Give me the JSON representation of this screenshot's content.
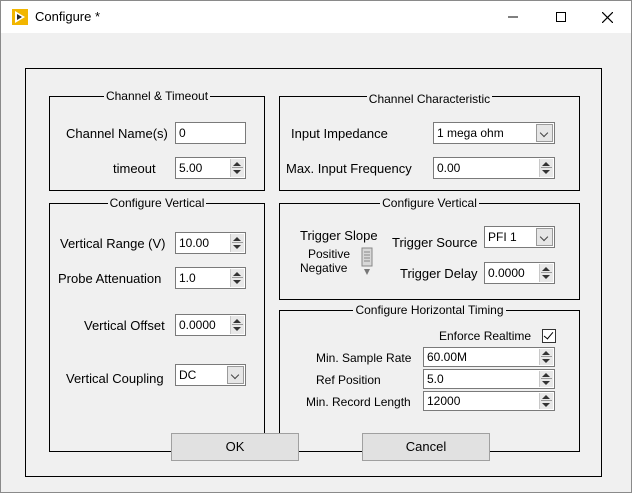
{
  "window": {
    "title": "Configure *",
    "icon": "labview-arrow-icon",
    "controls": [
      "minimize",
      "maximize",
      "close"
    ]
  },
  "channel_timeout": {
    "title": "Channel & Timeout",
    "channel_name_label": "Channel Name(s)",
    "channel_name_value": "0",
    "timeout_label": "timeout",
    "timeout_value": "5.00"
  },
  "channel_characteristic": {
    "title": "Channel Characteristic",
    "input_impedance_label": "Input Impedance",
    "input_impedance_value": "1 mega ohm",
    "max_freq_label": "Max. Input Frequency",
    "max_freq_value": "0.00"
  },
  "configure_vertical": {
    "title": "Configure Vertical",
    "range_label": "Vertical Range (V)",
    "range_value": "10.00",
    "probe_label": "Probe Attenuation",
    "probe_value": "1.0",
    "offset_label": "Vertical Offset",
    "offset_value": "0.0000",
    "coupling_label": "Vertical Coupling",
    "coupling_value": "DC"
  },
  "trigger": {
    "title": "Configure Vertical",
    "slope_label": "Trigger Slope",
    "slope_positive": "Positive",
    "slope_negative": "Negative",
    "source_label": "Trigger Source",
    "source_value": "PFI 1",
    "delay_label": "Trigger Delay",
    "delay_value": "0.0000"
  },
  "horizontal": {
    "title": "Configure Horizontal Timing",
    "enforce_label": "Enforce Realtime",
    "enforce_checked": true,
    "sample_rate_label": "Min. Sample Rate",
    "sample_rate_value": "60.00M",
    "ref_position_label": "Ref Position",
    "ref_position_value": "5.0",
    "record_length_label": "Min. Record Length",
    "record_length_value": "12000"
  },
  "buttons": {
    "ok": "OK",
    "cancel": "Cancel"
  }
}
